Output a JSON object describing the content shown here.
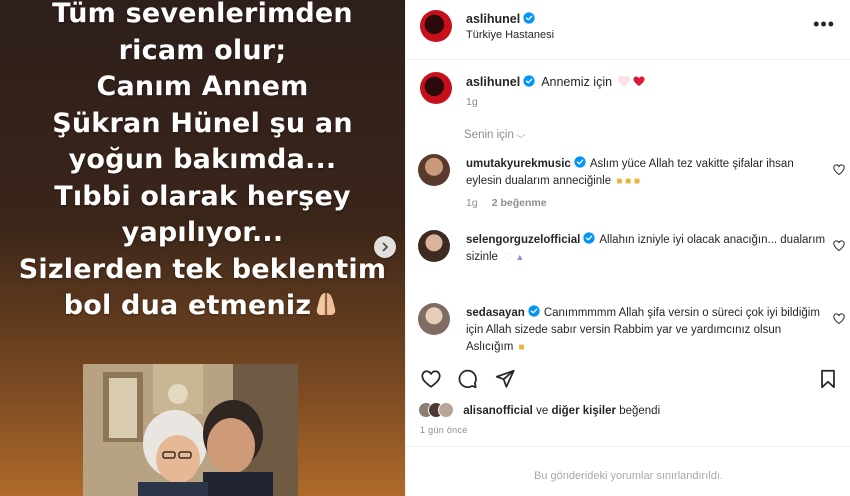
{
  "story": {
    "lines": [
      "Tüm sevenlerimden",
      "ricam olur;",
      "Canım Annem",
      "Şükran Hünel şu an",
      "yoğun bakımda...",
      "Tıbbi olarak herşey",
      "yapılıyor...",
      "Sizlerden tek beklentim",
      "bol dua etmeniz"
    ],
    "emoji_icon": "praying-hands-icon"
  },
  "post": {
    "author": "aslihunel",
    "location": "Türkiye Hastanesi",
    "caption_user": "aslihunel",
    "caption_text": "Annemiz için",
    "caption_time": "1g",
    "sort_label": "Senin için"
  },
  "comments": [
    {
      "user": "umutakyurekmusic",
      "verified": true,
      "text": "Aslım yüce Allah tez vakitte şifalar ihsan eylesin dualarım anneciğinle",
      "time": "1g",
      "likes": "2 beğenme"
    },
    {
      "user": "selengorguzelofficial",
      "verified": true,
      "text": "Allahın izniyle iyi olacak anacığın... dualarım sizinle"
    },
    {
      "user": "sedasayan",
      "verified": true,
      "text": "Canımmmmm Allah şifa versin o süreci çok iyi bildiğim için Allah sizede sabır versin Rabbim yar ve yardımcınız olsun Aslıcığım"
    }
  ],
  "likes": {
    "first_user": "alisanofficial",
    "joiner": "ve",
    "others": "diğer kişiler",
    "suffix": "beğendi"
  },
  "date_label": "1 gün önce",
  "restricted_text": "Bu gönderideki yorumlar sınırlandırıldı.",
  "colors": {
    "verified_blue": "#0095f6",
    "heart_red": "#ed4956",
    "muted_text": "#8e8e8e"
  }
}
